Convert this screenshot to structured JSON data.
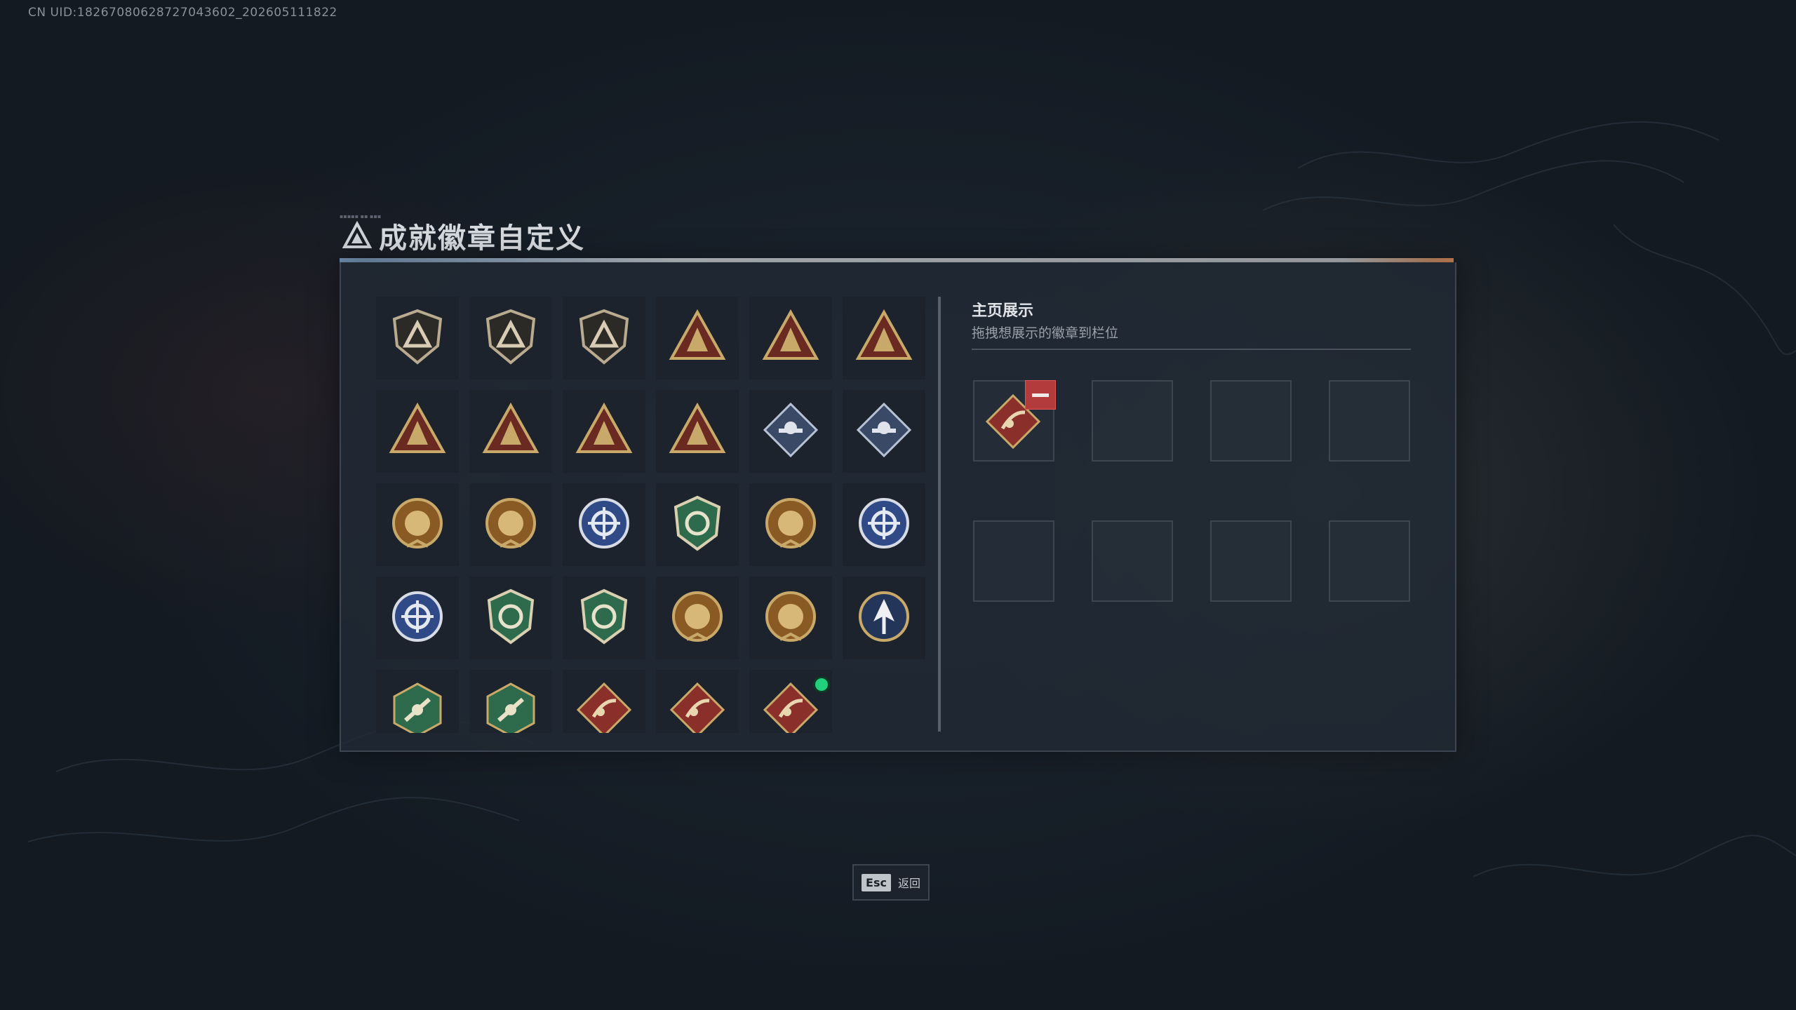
{
  "meta": {
    "uid": "CN UID:18267080628727043602_202605111822"
  },
  "window": {
    "title": "成就徽章自定义"
  },
  "badges": [
    {
      "icon": "delta-shield-badge-icon"
    },
    {
      "icon": "helicopter-badge-icon"
    },
    {
      "icon": "dagger-shield-badge-icon"
    },
    {
      "icon": "winged-skull-badge-icon"
    },
    {
      "icon": "rock-hand-badge-icon"
    },
    {
      "icon": "feather-wing-badge-icon"
    },
    {
      "icon": "number-one-badge-icon"
    },
    {
      "icon": "backpack-badge-icon"
    },
    {
      "icon": "kneeling-soldier-badge-icon"
    },
    {
      "icon": "flexing-soldier-badge-icon"
    },
    {
      "icon": "rose-diamond-badge-icon"
    },
    {
      "icon": "rifle-diamond-badge-icon"
    },
    {
      "icon": "sun-star-medal-icon"
    },
    {
      "icon": "gold-shield-medal-icon"
    },
    {
      "icon": "blue-round-medal-icon"
    },
    {
      "icon": "green-emerald-medal-icon"
    },
    {
      "icon": "tiger-medal-icon"
    },
    {
      "icon": "blue-star-burst-medal-icon"
    },
    {
      "icon": "blue-crosshair-medal-icon"
    },
    {
      "icon": "green-crosshair-medal-icon"
    },
    {
      "icon": "green-wreath-crosshair-medal-icon"
    },
    {
      "icon": "gold-scope-medal-icon"
    },
    {
      "icon": "gold-crosshair-medal-icon"
    },
    {
      "icon": "arrow-circle-medal-icon"
    },
    {
      "icon": "hornet-hex-badge-icon"
    },
    {
      "icon": "green-gun-hex-badge-icon"
    },
    {
      "icon": "red-runner-diamond-badge-icon"
    },
    {
      "icon": "red-crossbow-diamond-badge-icon"
    },
    {
      "icon": "red-scythe-diamond-badge-icon",
      "new": true
    }
  ],
  "showcase": {
    "title": "主页展示",
    "subtitle": "拖拽想展示的徽章到栏位",
    "slots": [
      {
        "filled": true,
        "icon": "red-scythe-diamond-badge-icon"
      },
      {
        "filled": false
      },
      {
        "filled": false
      },
      {
        "filled": false
      },
      {
        "filled": false
      },
      {
        "filled": false
      },
      {
        "filled": false
      },
      {
        "filled": false
      }
    ]
  },
  "footer": {
    "esc_key": "Esc",
    "esc_label": "返回"
  },
  "colors": {
    "new_indicator": "#21d07a",
    "remove_button": "#b43b3b",
    "gold": "#c8a96a",
    "red_badge": "#8a2f2a",
    "green_badge": "#2e6a4c",
    "blue_badge": "#2f4a86"
  }
}
